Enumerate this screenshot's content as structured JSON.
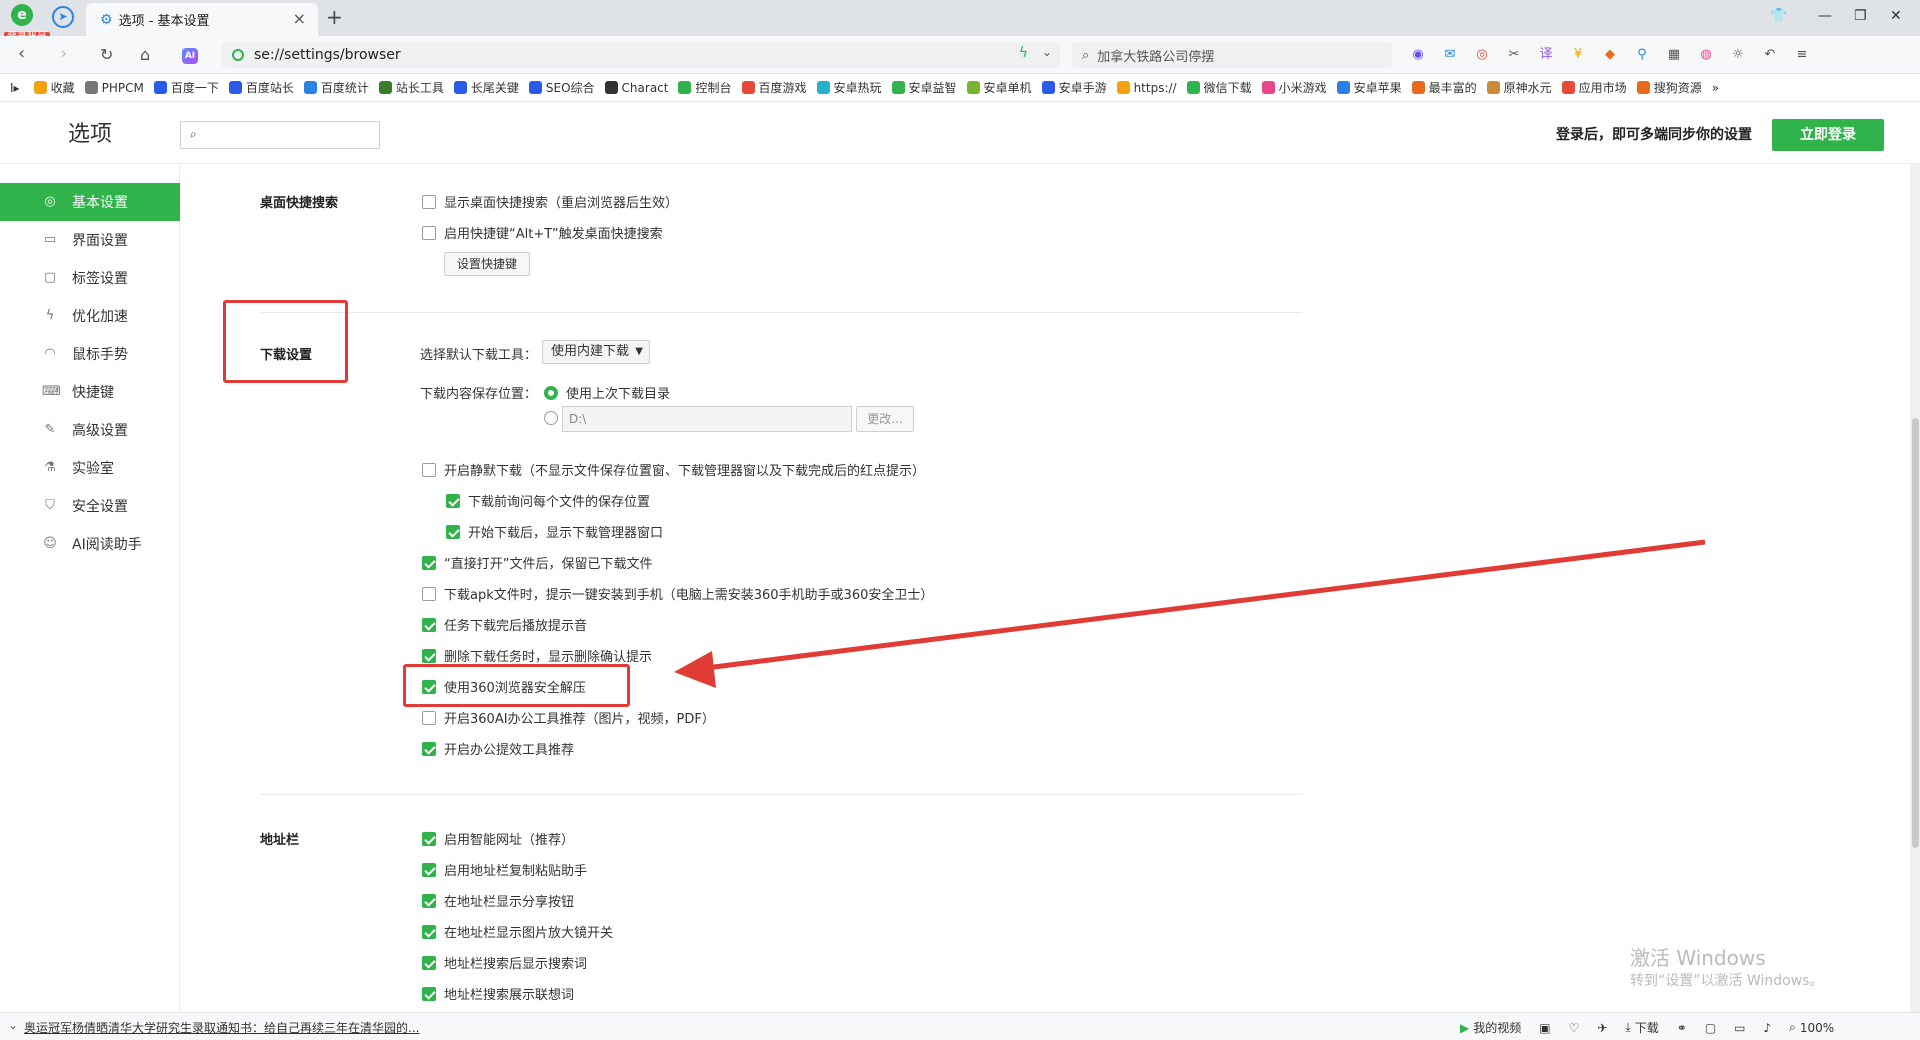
{
  "browser": {
    "login_badge": "登录账号",
    "tab_title": "选项 - 基本设置",
    "url": "se://settings/browser",
    "search_placeholder": "加拿大铁路公司停摆",
    "accent_color": "#2fb34a"
  },
  "bookmarks": [
    {
      "label": "收藏",
      "color": "#f2a20c"
    },
    {
      "label": "PHPCM",
      "color": "#777777"
    },
    {
      "label": "百度一下",
      "color": "#2a5ae8"
    },
    {
      "label": "百度站长",
      "color": "#2a5ae8"
    },
    {
      "label": "百度统计",
      "color": "#2a82e4"
    },
    {
      "label": "站长工具",
      "color": "#3a7c2a"
    },
    {
      "label": "长尾关键",
      "color": "#2a5ae8"
    },
    {
      "label": "SEO综合",
      "color": "#2a5ae8"
    },
    {
      "label": "Charact",
      "color": "#333333"
    },
    {
      "label": "控制台",
      "color": "#2fb34a"
    },
    {
      "label": "百度游戏",
      "color": "#e84a3a"
    },
    {
      "label": "安卓热玩",
      "color": "#26b3c9"
    },
    {
      "label": "安卓益智",
      "color": "#2fb34a"
    },
    {
      "label": "安卓单机",
      "color": "#7ab32f"
    },
    {
      "label": "安卓手游",
      "color": "#2a5ae8"
    },
    {
      "label": "https://",
      "color": "#f2a20c"
    },
    {
      "label": "微信下载",
      "color": "#2fb34a"
    },
    {
      "label": "小米游戏",
      "color": "#e8458a"
    },
    {
      "label": "安卓苹果",
      "color": "#2a82e4"
    },
    {
      "label": "最丰富的",
      "color": "#e86a1a"
    },
    {
      "label": "原神水元",
      "color": "#c98a3a"
    },
    {
      "label": "应用市场",
      "color": "#e84a3a"
    },
    {
      "label": "搜狗资源",
      "color": "#e86a1a"
    }
  ],
  "bookmarks_more": "»",
  "header": {
    "title": "选项",
    "sync_text": "登录后，即可多端同步你的设置",
    "login_button": "立即登录"
  },
  "sidebar": {
    "items": [
      {
        "label": "基本设置",
        "icon": "◎"
      },
      {
        "label": "界面设置",
        "icon": "▭"
      },
      {
        "label": "标签设置",
        "icon": "▢"
      },
      {
        "label": "优化加速",
        "icon": "ϟ"
      },
      {
        "label": "鼠标手势",
        "icon": "◠"
      },
      {
        "label": "快捷键",
        "icon": "⌨"
      },
      {
        "label": "高级设置",
        "icon": "✎"
      },
      {
        "label": "实验室",
        "icon": "⚗"
      },
      {
        "label": "安全设置",
        "icon": "⛉"
      },
      {
        "label": "AI阅读助手",
        "icon": "☺"
      }
    ]
  },
  "desktop_search": {
    "label": "桌面快捷搜索",
    "opt1": "显示桌面快捷搜索（重启浏览器后生效）",
    "opt2": "启用快捷键“Alt+T”触发桌面快捷搜索",
    "button": "设置快捷键"
  },
  "download": {
    "label": "下载设置",
    "tool_label": "选择默认下载工具：",
    "tool_value": "使用内建下载",
    "location_label": "下载内容保存位置：",
    "location_opt1": "使用上次下载目录",
    "path_value": "D:\\",
    "change_button": "更改...",
    "options": [
      {
        "text": "开启静默下载（不显示文件保存位置窗、下载管理器窗以及下载完成后的红点提示）",
        "checked": false,
        "indent": false
      },
      {
        "text": "下载前询问每个文件的保存位置",
        "checked": true,
        "indent": true
      },
      {
        "text": "开始下载后，显示下载管理器窗口",
        "checked": true,
        "indent": true
      },
      {
        "text": "“直接打开”文件后，保留已下载文件",
        "checked": true,
        "indent": false
      },
      {
        "text": "下载apk文件时，提示一键安装到手机（电脑上需安装360手机助手或360安全卫士）",
        "checked": false,
        "indent": false
      },
      {
        "text": "任务下载完后播放提示音",
        "checked": true,
        "indent": false
      },
      {
        "text": "删除下载任务时，显示删除确认提示",
        "checked": true,
        "indent": false
      },
      {
        "text": "使用360浏览器安全解压",
        "checked": true,
        "indent": false
      },
      {
        "text": "开启360AI办公工具推荐（图片，视频，PDF）",
        "checked": false,
        "indent": false
      },
      {
        "text": "开启办公提效工具推荐",
        "checked": true,
        "indent": false
      }
    ]
  },
  "address_bar": {
    "label": "地址栏",
    "options": [
      {
        "text": "启用智能网址（推荐）",
        "checked": true
      },
      {
        "text": "启用地址栏复制粘贴助手",
        "checked": true
      },
      {
        "text": "在地址栏显示分享按钮",
        "checked": true
      },
      {
        "text": "在地址栏显示图片放大镜开关",
        "checked": true
      },
      {
        "text": "地址栏搜索后显示搜索词",
        "checked": true
      },
      {
        "text": "地址栏搜索展示联想词",
        "checked": true
      }
    ]
  },
  "watermark": {
    "line1": "激活 Windows",
    "line2": "转到“设置”以激活 Windows。"
  },
  "statusbar": {
    "news": "奥运冠军杨倩晒清华大学研究生录取通知书：给自己再续三年在清华园的...",
    "video": "我的视频",
    "download": "下载",
    "zoom": "100%"
  }
}
